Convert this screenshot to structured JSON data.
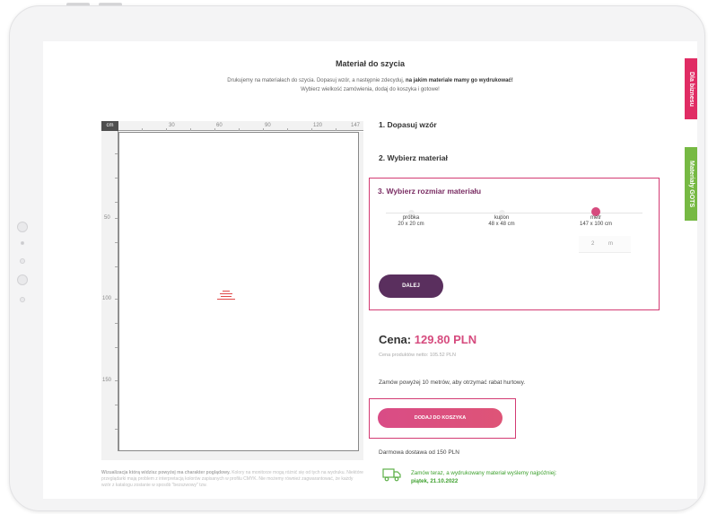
{
  "page": {
    "title": "Materiał do szycia",
    "intro_line1_plain": "Drukujemy na materiałach do szycia. Dopasuj wzór, a następnie zdecyduj,",
    "intro_line1_bold": "na jakim materiale mamy go wydrukować!",
    "intro_line2": "Wybierz wielkość zamówienia, dodaj do koszyka i gotowe!"
  },
  "side_tabs": {
    "business": "Dla biznesu",
    "gots": "Materiały GOTS"
  },
  "ruler": {
    "unit": "cm",
    "top_ticks": [
      "30",
      "60",
      "90",
      "120",
      "147"
    ],
    "left_ticks": [
      "50",
      "100",
      "150"
    ]
  },
  "disclaimer": {
    "bold": "Wizualizacja którą widzisz powyżej ma charakter poglądowy.",
    "text": "Kolory na monitorze mogą różnić się od tych na wydruku. Niektóre przeglądarki mają problem z interpretacją kolorów zapisanych w profilu CMYK. Nie możemy również zagwarantować, że każdy wzór z katalogu zostanie w sposób \"bezszwowy\" tzw."
  },
  "steps": {
    "step1": "1. Dopasuj wzór",
    "step2": "2. Wybierz materiał",
    "step3": "3. Wybierz rozmiar materiału"
  },
  "sizes": [
    {
      "name": "próbka",
      "dims": "20 x 20 cm",
      "selected": false
    },
    {
      "name": "kupon",
      "dims": "48 x 48 cm",
      "selected": false
    },
    {
      "name": "metr",
      "dims": "147 x 100 cm",
      "selected": true
    }
  ],
  "quantity": {
    "value": "2",
    "unit": "m"
  },
  "buttons": {
    "next": "DALEJ",
    "add_to_cart": "DODAJ DO KOSZYKA"
  },
  "price": {
    "label": "Cena:",
    "value": "129.80 PLN",
    "net": "Cena produktów netto: 105.52 PLN"
  },
  "bulk_message": "Zamów powyżej 10 metrów, aby otrzymać rabat hurtowy.",
  "free_shipping": "Darmowa dostawa od 150 PLN",
  "shipping": {
    "line1": "Zamów teraz, a wydrukowany materiał wyślemy najpóźniej:",
    "date": "piątek, 21.10.2022",
    "icon": "truck-icon"
  },
  "colors": {
    "accent_pink": "#d33b73",
    "button_purple": "#5a2f5e",
    "price_pink": "#d64b7e",
    "ship_green": "#3ea12e",
    "tab_business": "#e02c64",
    "tab_gots": "#76b943"
  }
}
